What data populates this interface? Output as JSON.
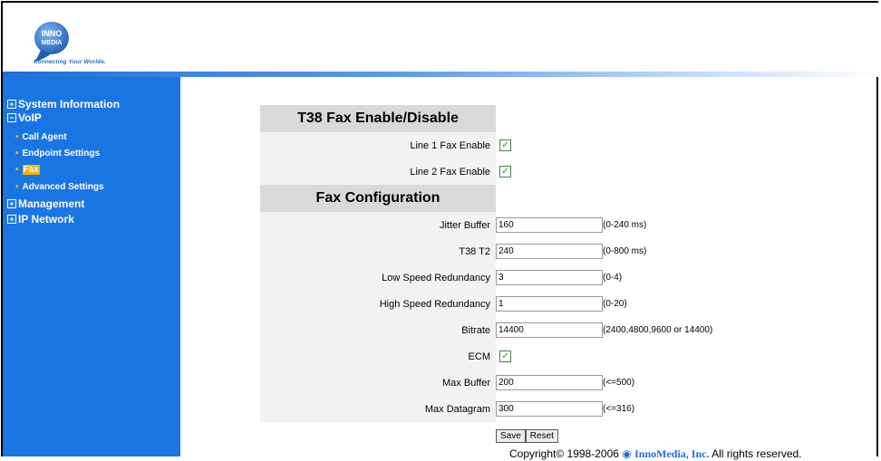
{
  "header": {
    "logo_text": "INNO MEDIA",
    "tagline": "Connecting Your Worlds."
  },
  "sidebar": {
    "items": [
      {
        "label": "System Information",
        "toggle": "+"
      },
      {
        "label": "VoIP",
        "toggle": "-"
      },
      {
        "label": "Management",
        "toggle": "+"
      },
      {
        "label": "IP Network",
        "toggle": "+"
      }
    ],
    "voip_sub": [
      {
        "label": "Call Agent"
      },
      {
        "label": "Endpoint Settings"
      },
      {
        "label": "Fax"
      },
      {
        "label": "Advanced Settings"
      }
    ]
  },
  "t38": {
    "title": "T38 Fax Enable/Disable",
    "line1_label": "Line 1 Fax Enable",
    "line2_label": "Line 2 Fax Enable",
    "line1_checked": true,
    "line2_checked": true
  },
  "fax": {
    "title": "Fax Configuration",
    "jitter_label": "Jitter Buffer",
    "jitter_value": "160",
    "jitter_range": "(0-240 ms)",
    "t38t2_label": "T38 T2",
    "t38t2_value": "240",
    "t38t2_range": "(0-800 ms)",
    "low_label": "Low Speed Redundancy",
    "low_value": "3",
    "low_range": "(0-4)",
    "high_label": "High Speed Redundancy",
    "high_value": "1",
    "high_range": "(0-20)",
    "bitrate_label": "Bitrate",
    "bitrate_value": "14400",
    "bitrate_range": "(2400,4800,9600 or 14400)",
    "ecm_label": "ECM",
    "ecm_checked": true,
    "maxbuf_label": "Max Buffer",
    "maxbuf_value": "200",
    "maxbuf_range": "(<=500)",
    "maxdg_label": "Max Datagram",
    "maxdg_value": "300",
    "maxdg_range": "(<=316)"
  },
  "buttons": {
    "save": "Save",
    "reset": "Reset"
  },
  "footer": {
    "copyright": "Copyright© 1998-2006",
    "brand": "InnoMedia, Inc.",
    "rights": "All rights reserved."
  },
  "colors": {
    "sidebar": "#1a75e4",
    "active": "#f5b400",
    "section": "#d9d9d9"
  }
}
